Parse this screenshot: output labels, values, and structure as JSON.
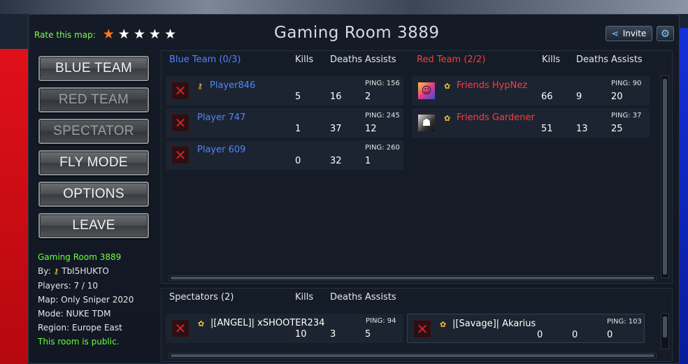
{
  "room_title": "Gaming Room 3889",
  "rate_label": "Rate this map:",
  "rating": {
    "filled": 1,
    "total": 5
  },
  "invite_label": "Invite",
  "menu": [
    {
      "label": "BLUE TEAM",
      "enabled": true
    },
    {
      "label": "RED TEAM",
      "enabled": false
    },
    {
      "label": "SPECTATOR",
      "enabled": false
    },
    {
      "label": "FLY MODE",
      "enabled": true
    },
    {
      "label": "OPTIONS",
      "enabled": true
    },
    {
      "label": "LEAVE",
      "enabled": true
    }
  ],
  "room_info": {
    "name": "Gaming Room 3889",
    "by": "By:",
    "owner": "TbI5HUKTO",
    "players": "Players: 7 / 10",
    "map": "Map: Only Sniper 2020",
    "mode": "Mode: NUKE TDM",
    "region": "Region: Europe East",
    "public": "This room is public."
  },
  "blue_team": {
    "header": "Blue Team (0/3)",
    "col_kills": "Kills",
    "col_deaths": "Deaths",
    "col_assists": "Assists",
    "players": [
      {
        "name": "Player846",
        "kills": "5",
        "deaths": "16",
        "assists": "2",
        "ping": "PING: 156",
        "has_key": true
      },
      {
        "name": "Player 747",
        "kills": "1",
        "deaths": "37",
        "assists": "12",
        "ping": "PING: 245",
        "has_key": false
      },
      {
        "name": "Player 609",
        "kills": "0",
        "deaths": "32",
        "assists": "1",
        "ping": "PING: 260",
        "has_key": false
      }
    ]
  },
  "red_team": {
    "header": "Red Team (2/2)",
    "col_kills": "Kills",
    "col_deaths": "Deaths",
    "col_assists": "Assists",
    "players": [
      {
        "name": "Friends HypNez",
        "kills": "66",
        "deaths": "9",
        "assists": "20",
        "ping": "PING: 90"
      },
      {
        "name": "Friends Gardener",
        "kills": "51",
        "deaths": "13",
        "assists": "25",
        "ping": "PING: 37"
      }
    ]
  },
  "spectators": {
    "header": "Spectators (2)",
    "col_kills": "Kills",
    "col_deaths": "Deaths",
    "col_assists": "Assists",
    "players": [
      {
        "name": "|[ANGEL]| xSHOOTER234",
        "kills": "10",
        "deaths": "3",
        "assists": "5",
        "ping": "PING: 94"
      },
      {
        "name": "|[Savage]| Akarius",
        "kills": "0",
        "deaths": "0",
        "assists": "0",
        "ping": "PING: 103"
      }
    ]
  },
  "colors": {
    "blue": "#4f83ff",
    "red": "#ff3b3b",
    "green": "#6dff3c",
    "star_on": "#ff7a1a"
  }
}
